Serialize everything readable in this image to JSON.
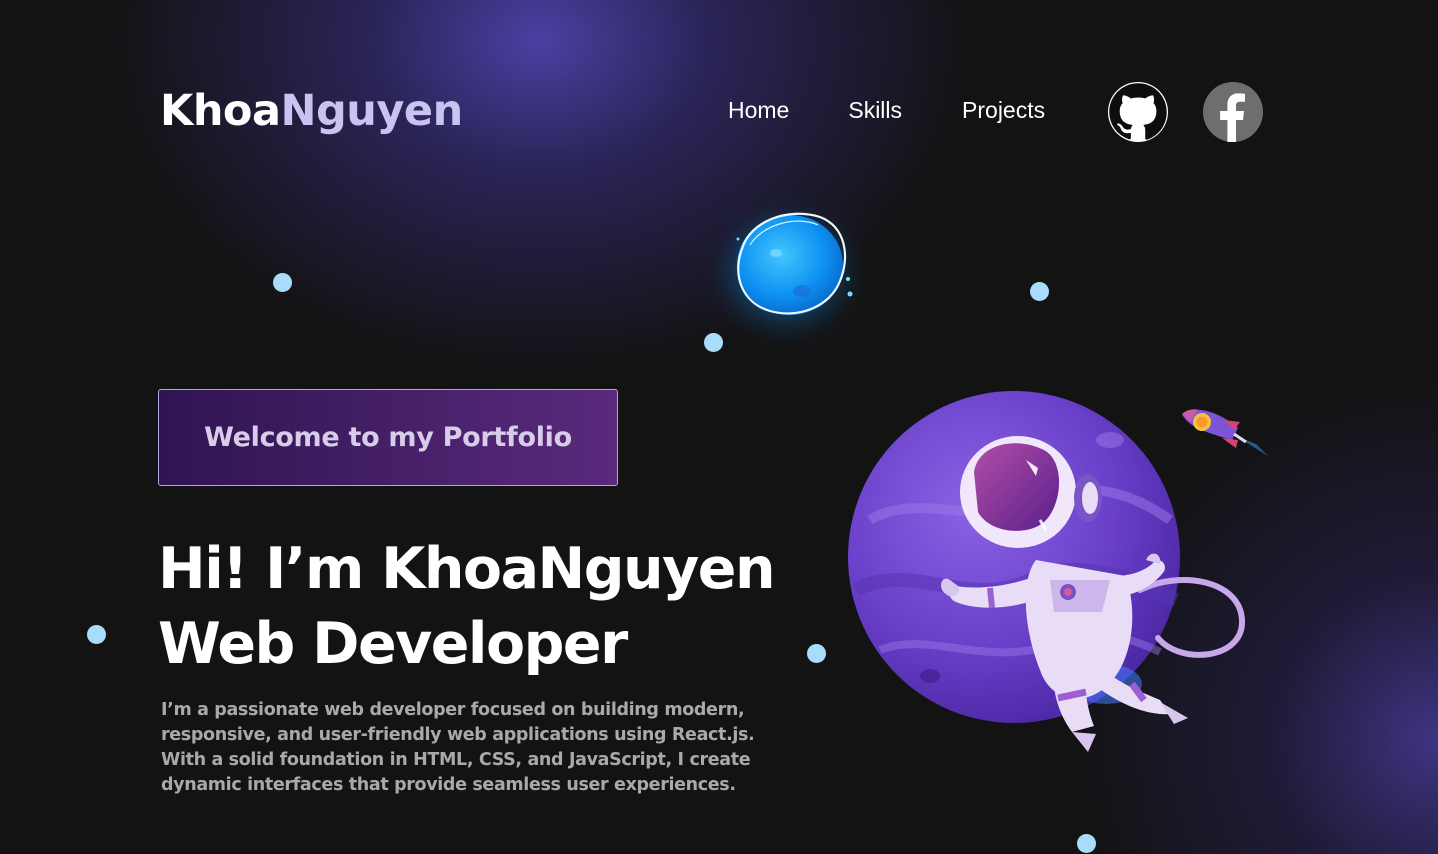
{
  "header": {
    "logo_main": "Khoa",
    "logo_accent": "Nguyen",
    "nav": [
      {
        "label": "Home"
      },
      {
        "label": "Skills"
      },
      {
        "label": "Projects"
      }
    ],
    "social": [
      {
        "name": "github",
        "icon": "github-icon",
        "bg": "#ffffff"
      },
      {
        "name": "facebook",
        "icon": "facebook-icon",
        "bg": "#6e6e6e"
      }
    ]
  },
  "hero": {
    "welcome": "Welcome to my Portfolio",
    "title_line1": "Hi! I’m KhoaNguyen",
    "title_line2": "Web Developer",
    "bio": "I’m a passionate web developer focused on building modern, responsive, and user-friendly web applications using React.js. With a solid foundation in HTML, CSS, and JavaScript, I create dynamic interfaces that provide seamless user experiences."
  },
  "art": {
    "planet_blob": "glowing-blue-planet-icon",
    "astronaut": "astronaut-on-planet-illustration",
    "rocket": "rocket-icon"
  },
  "colors": {
    "background": "#131314",
    "accent_purple": "#4e42aa",
    "dot": "#a8dcfb",
    "welcome_border": "#b9a3e0"
  }
}
